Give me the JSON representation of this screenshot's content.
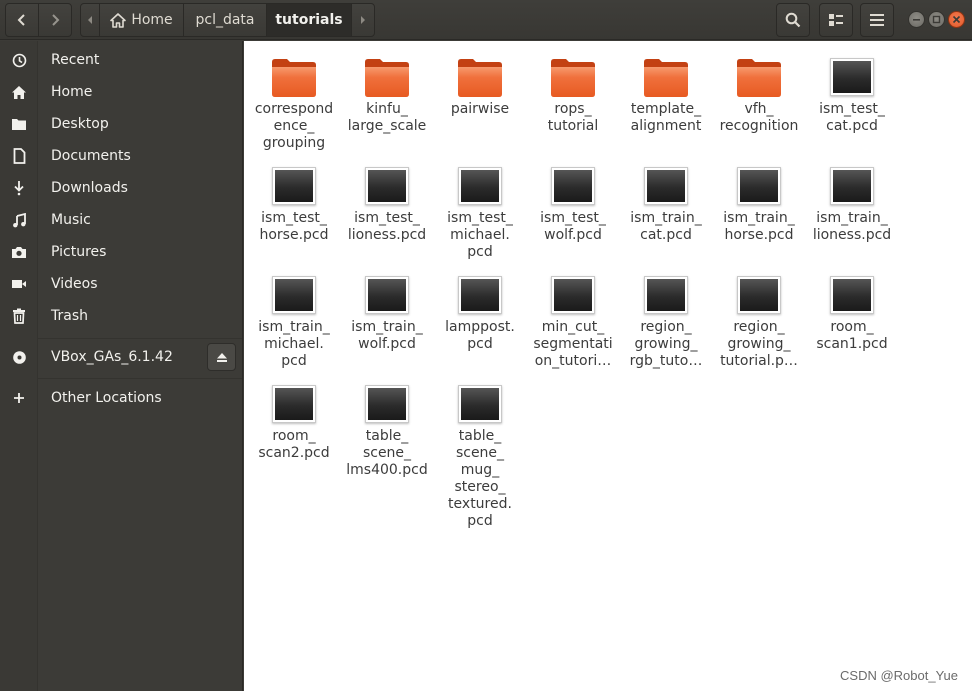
{
  "header": {
    "breadcrumbs": [
      {
        "label": "Home",
        "icon": "home-icon"
      },
      {
        "label": "pcl_data"
      },
      {
        "label": "tutorials"
      }
    ]
  },
  "sidebar": {
    "items": [
      {
        "label": "Recent",
        "icon": "clock-icon"
      },
      {
        "label": "Home",
        "icon": "home-icon"
      },
      {
        "label": "Desktop",
        "icon": "folder-icon"
      },
      {
        "label": "Documents",
        "icon": "document-icon"
      },
      {
        "label": "Downloads",
        "icon": "download-icon"
      },
      {
        "label": "Music",
        "icon": "music-icon"
      },
      {
        "label": "Pictures",
        "icon": "camera-icon"
      },
      {
        "label": "Videos",
        "icon": "video-icon"
      },
      {
        "label": "Trash",
        "icon": "trash-icon"
      }
    ],
    "device": {
      "label": "VBox_GAs_6.1.42",
      "icon": "disc-icon"
    },
    "other": {
      "label": "Other Locations",
      "icon": "plus-icon"
    }
  },
  "files": [
    {
      "lines": [
        "correspond",
        "ence_",
        "grouping"
      ],
      "kind": "folder"
    },
    {
      "lines": [
        "kinfu_",
        "large_scale"
      ],
      "kind": "folder"
    },
    {
      "lines": [
        "pairwise"
      ],
      "kind": "folder"
    },
    {
      "lines": [
        "rops_",
        "tutorial"
      ],
      "kind": "folder"
    },
    {
      "lines": [
        "template_",
        "alignment"
      ],
      "kind": "folder"
    },
    {
      "lines": [
        "vfh_",
        "recognition"
      ],
      "kind": "folder"
    },
    {
      "lines": [
        "ism_test_",
        "cat.pcd"
      ],
      "kind": "pcd"
    },
    {
      "lines": [
        "ism_test_",
        "horse.pcd"
      ],
      "kind": "pcd"
    },
    {
      "lines": [
        "ism_test_",
        "lioness.pcd"
      ],
      "kind": "pcd"
    },
    {
      "lines": [
        "ism_test_",
        "michael.",
        "pcd"
      ],
      "kind": "pcd"
    },
    {
      "lines": [
        "ism_test_",
        "wolf.pcd"
      ],
      "kind": "pcd"
    },
    {
      "lines": [
        "ism_train_",
        "cat.pcd"
      ],
      "kind": "pcd"
    },
    {
      "lines": [
        "ism_train_",
        "horse.pcd"
      ],
      "kind": "pcd"
    },
    {
      "lines": [
        "ism_train_",
        "lioness.pcd"
      ],
      "kind": "pcd"
    },
    {
      "lines": [
        "ism_train_",
        "michael.",
        "pcd"
      ],
      "kind": "pcd"
    },
    {
      "lines": [
        "ism_train_",
        "wolf.pcd"
      ],
      "kind": "pcd"
    },
    {
      "lines": [
        "lamppost.",
        "pcd"
      ],
      "kind": "pcd"
    },
    {
      "lines": [
        "min_cut_",
        "segmentati",
        "on_tutori…"
      ],
      "kind": "pcd"
    },
    {
      "lines": [
        "region_",
        "growing_",
        "rgb_tuto…"
      ],
      "kind": "pcd"
    },
    {
      "lines": [
        "region_",
        "growing_",
        "tutorial.p…"
      ],
      "kind": "pcd"
    },
    {
      "lines": [
        "room_",
        "scan1.pcd"
      ],
      "kind": "pcd"
    },
    {
      "lines": [
        "room_",
        "scan2.pcd"
      ],
      "kind": "pcd"
    },
    {
      "lines": [
        "table_",
        "scene_",
        "lms400.pcd"
      ],
      "kind": "pcd"
    },
    {
      "lines": [
        "table_",
        "scene_",
        "mug_",
        "stereo_",
        "textured.",
        "pcd"
      ],
      "kind": "pcd"
    }
  ],
  "watermark": "CSDN @Robot_Yue",
  "colors": {
    "accent": "#e95420",
    "sidebar": "#3c3b37",
    "header": "#3b3a36"
  }
}
